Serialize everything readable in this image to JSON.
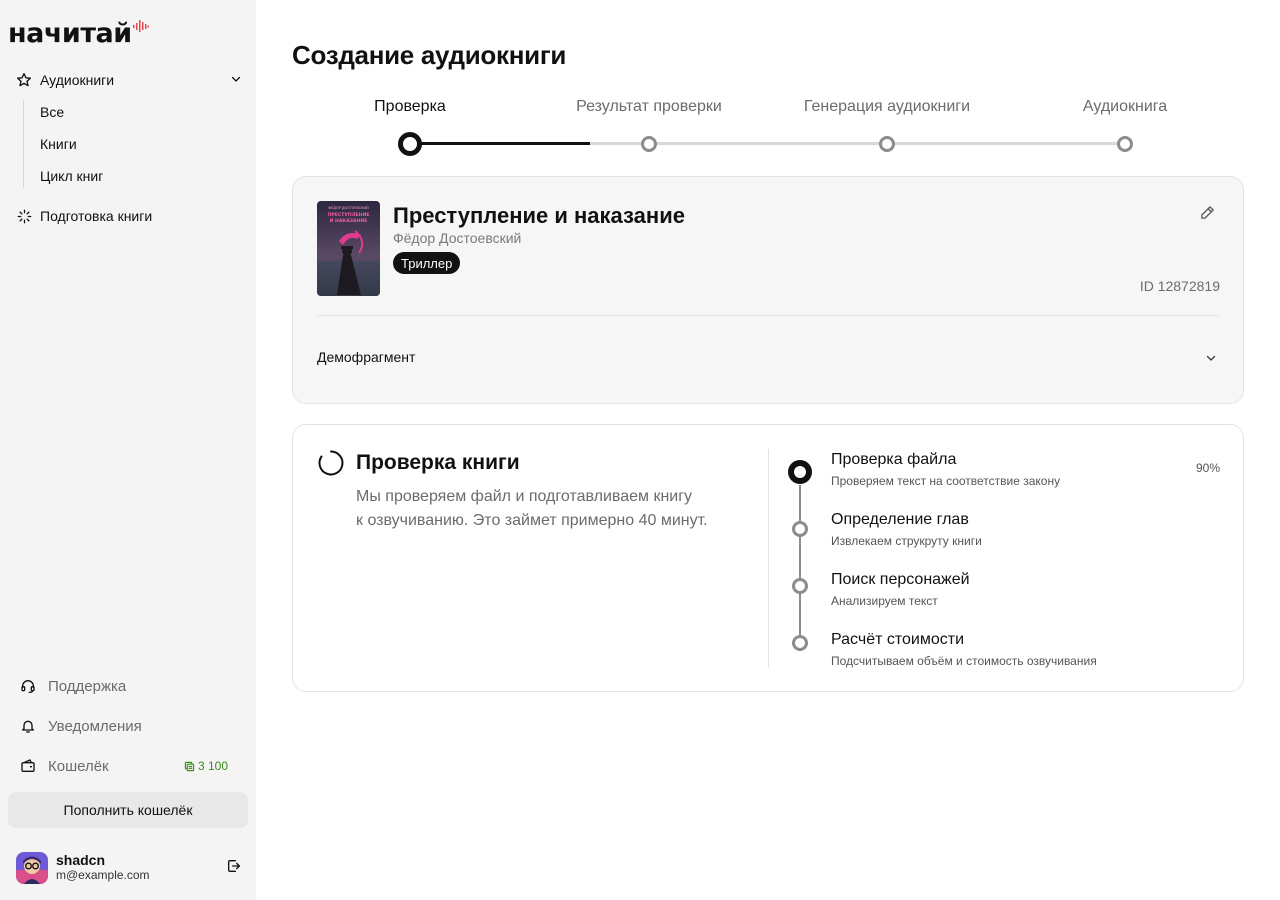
{
  "app": {
    "logo_text": "начитай",
    "brand_accent": "#e5484d"
  },
  "sidebar": {
    "audiobooks_label": "Аудиокниги",
    "sub_items": [
      {
        "label": "Все"
      },
      {
        "label": "Книги"
      },
      {
        "label": "Цикл книг"
      }
    ],
    "prep_label": "Подготовка книги",
    "support_label": "Поддержка",
    "notifications_label": "Уведомления",
    "wallet_label": "Кошелёк",
    "wallet_balance": "3 100",
    "topup_label": "Пополнить кошелёк",
    "user": {
      "name": "shadcn",
      "email": "m@example.com"
    }
  },
  "page": {
    "title": "Создание аудиокниги"
  },
  "stepper": {
    "steps": [
      {
        "label": "Проверка",
        "state": "active"
      },
      {
        "label": "Результат проверки",
        "state": "pending"
      },
      {
        "label": "Генерация аудиокниги",
        "state": "pending"
      },
      {
        "label": "Аудиокнига",
        "state": "pending"
      }
    ]
  },
  "book": {
    "title": "Преступление и наказание",
    "author": "Фёдор Достоевский",
    "genre": "Триллер",
    "id_text": "ID 12872819",
    "cover_author": "ФЁДОР ДОСТОЕВСКИЙ",
    "cover_title_1": "ПРЕСТУПЛЕНИЕ",
    "cover_title_2": "И НАКАЗАНИЕ",
    "demo_label": "Демофрагмент"
  },
  "check": {
    "title": "Проверка книги",
    "desc_line1": "Мы проверяем файл и подготавливаем книгу",
    "desc_line2": "к озвучиванию. Это займет примерно 40 минут.",
    "tasks": [
      {
        "name": "Проверка файла",
        "sub": "Проверяем текст на соответствие закону",
        "progress": "90%",
        "state": "active"
      },
      {
        "name": "Определение глав",
        "sub": "Извлекаем струкруту книги",
        "state": "pending"
      },
      {
        "name": "Поиск персонажей",
        "sub": "Анализируем текст",
        "state": "pending"
      },
      {
        "name": "Расчёт стоимости",
        "sub": "Подсчитываем объём и стоимость озвучивания",
        "state": "pending"
      }
    ]
  }
}
